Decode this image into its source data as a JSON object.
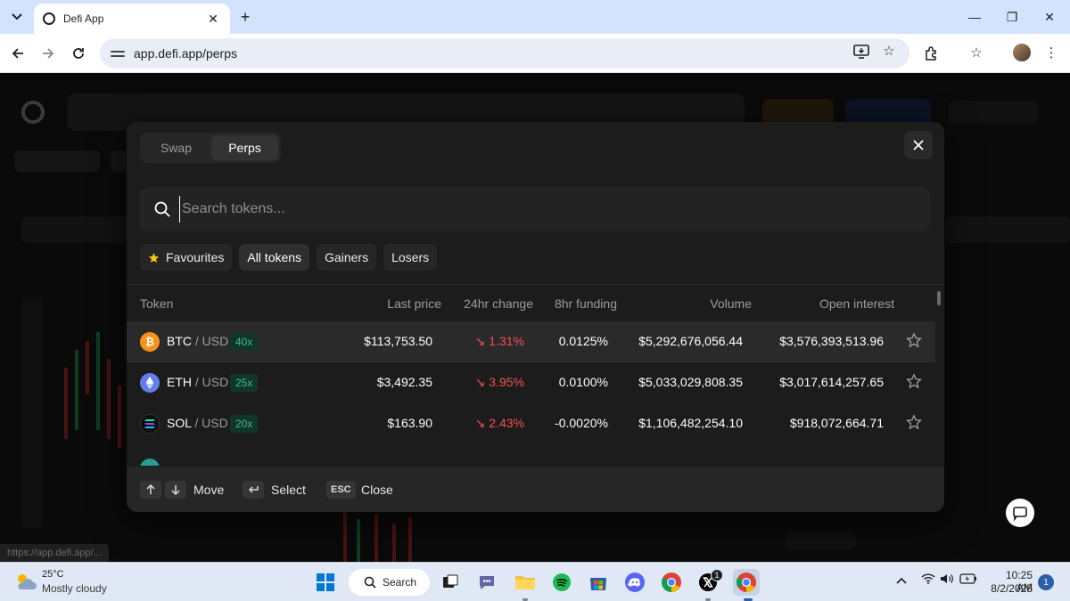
{
  "browser": {
    "tab_title": "Defi App",
    "url": "app.defi.app/perps",
    "status_url": "https://app.defi.app/..."
  },
  "modal": {
    "tabs": [
      {
        "label": "Swap",
        "active": false
      },
      {
        "label": "Perps",
        "active": true
      }
    ],
    "search_placeholder": "Search tokens...",
    "filters": [
      {
        "label": "Favourites",
        "icon": "star-icon",
        "active": false
      },
      {
        "label": "All tokens",
        "active": true
      },
      {
        "label": "Gainers",
        "active": false
      },
      {
        "label": "Losers",
        "active": false
      }
    ],
    "columns": {
      "token": "Token",
      "last_price": "Last price",
      "change_24h": "24hr change",
      "funding_8h": "8hr funding",
      "volume": "Volume",
      "open_interest": "Open interest"
    },
    "rows": [
      {
        "base": "BTC",
        "quote": " / USD",
        "leverage": "40x",
        "last_price": "$113,753.50",
        "change": "↘ 1.31%",
        "funding": "0.0125%",
        "volume": "$5,292,676,056.44",
        "open_interest": "$3,576,393,513.96",
        "coin_color": "#f7931a",
        "highlight": true
      },
      {
        "base": "ETH",
        "quote": " / USD",
        "leverage": "25x",
        "last_price": "$3,492.35",
        "change": "↘ 3.95%",
        "funding": "0.0100%",
        "volume": "$5,033,029,808.35",
        "open_interest": "$3,017,614,257.65",
        "coin_color": "#627eea",
        "highlight": false
      },
      {
        "base": "SOL",
        "quote": " / USD",
        "leverage": "20x",
        "last_price": "$163.90",
        "change": "↘ 2.43%",
        "funding": "-0.0020%",
        "volume": "$1,106,482,254.10",
        "open_interest": "$918,072,664.71",
        "coin_color": "#0f0f0f",
        "highlight": false
      }
    ],
    "footer": {
      "move": "Move",
      "select": "Select",
      "esc_key": "ESC",
      "close": "Close"
    }
  },
  "taskbar": {
    "weather_temp": "25°C",
    "weather_desc": "Mostly cloudy",
    "search_label": "Search",
    "time": "10:25 AM",
    "date": "8/2/2025",
    "notification_count": "1",
    "x_badge": "1"
  },
  "colors": {
    "accent_green": "#3fbf85",
    "negative_red": "#f0534f",
    "modal_bg": "#1c1c1c"
  }
}
